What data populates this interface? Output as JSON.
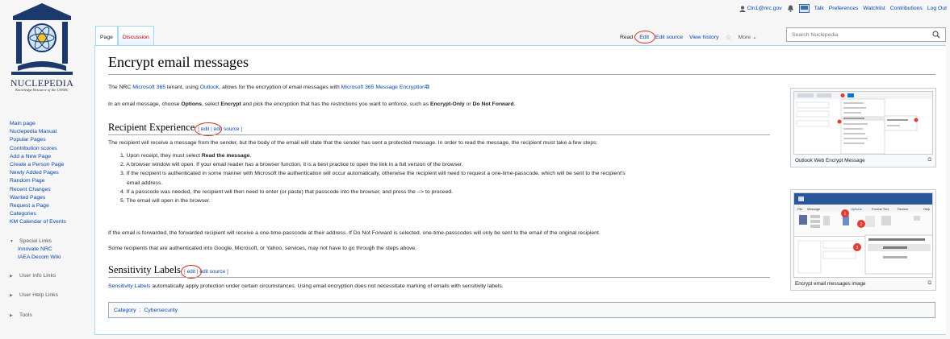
{
  "logo": {
    "name": "NUCLEPEDIA",
    "tagline": "Knowledge Resource of the USNRC"
  },
  "personal": {
    "user": "Cln1@nrc.gov",
    "items": [
      "Talk",
      "Preferences",
      "Watchlist",
      "Contributions",
      "Log Out"
    ]
  },
  "sidebar": {
    "portal": [
      "Main page",
      "Nuclepedia Manual",
      "Popular Pages",
      "Contribution scores",
      "Add a New Page",
      "Create a Person Page",
      "Newly Added Pages",
      "Random Page",
      "Recent Changes",
      "Wanted Pages",
      "Request a Page",
      "Categories",
      "KM Calendar of Events"
    ],
    "special_links": {
      "label": "Special Links",
      "items": [
        "Innovate NRC",
        "IAEA Decom Wiki"
      ]
    },
    "collapsed": [
      "User Info Links",
      "User Help Links",
      "Tools"
    ]
  },
  "tabs": {
    "left": [
      "Page",
      "Discussion"
    ],
    "right": {
      "read": "Read",
      "edit": "Edit",
      "edit_source": "Edit source",
      "view_history": "View history",
      "more": "More"
    }
  },
  "search": {
    "placeholder": "Search Nuclepedia"
  },
  "content": {
    "title": "Encrypt email messages",
    "intro": {
      "t1": "The NRC ",
      "l1": "Microsoft 365",
      "t2": " tenant, using ",
      "l2": "Outlook",
      "t3": ", allows for the encryption of email messages with ",
      "l3": "Microsoft 365 Message Encryption"
    },
    "options": {
      "t1": "In an email message, choose ",
      "b1": "Options",
      "t2": ", select ",
      "b2": "Encrypt",
      "t3": " and pick the encryption that has the restrictions you want to enforce, such as ",
      "b3": "Encrypt-Only",
      "t4": " or ",
      "b4": "Do Not Forward",
      "t5": "."
    },
    "section1": {
      "heading": "Recipient Experience",
      "edit": "edit",
      "edit_source": "edit source",
      "lead": "The recipient will receive a message from the sender, but the body of the email will state that the sender has sent a protected message. In order to read the message, the recipient must take a few steps:",
      "steps": [
        {
          "n": "1.",
          "t": "Upon receipt, they must select ",
          "b": "Read the message",
          "e": "."
        },
        {
          "n": "2.",
          "t": "A browser window will open. If your email reader has a browser function, it is a best practice to open the link in a full version of the browser."
        },
        {
          "n": "3.",
          "t": "If the recipient is authenticated in some manner with Microsoft the authentication will occur automatically, otherwise the recipient will need to request a one-time-passcode, which will be sent to the recipient's"
        },
        {
          "n": "",
          "t": "email address."
        },
        {
          "n": "4.",
          "t": "If a passcode was needed, the recipient will then need to enter (or paste) that passcode into the browser, and press the --> to proceed."
        },
        {
          "n": "5.",
          "t": "The email will open in the browser."
        }
      ],
      "forward": "If the email is forwarded, the forwarded recipient will receive a one-time-passcode at their address. If Do Not Forward is selected, one-time-passcodes will only be sent to the email of the original recipient.",
      "auth": "Some recipients that are authenticated into Google, Microsoft, or Yahoo, services, may not have to go through the steps above."
    },
    "section2": {
      "heading": "Sensitivity Labels",
      "edit": "edit",
      "edit_source": "edit source",
      "l1": "Sensitivity Labels",
      "t1": " automatically apply protection under certain circumstances. Using email encryption does not necessitate marking of emails with sensitivity labels."
    },
    "thumbs": [
      {
        "caption": "Outlook Web Encrypt Message"
      },
      {
        "caption": "Encrypt email messages image",
        "markers": [
          "1",
          "2",
          "3"
        ]
      }
    ],
    "category": {
      "label": "Category",
      "value": "Cybersecurity"
    }
  },
  "colors": {
    "link": "#0645ad",
    "highlight": "#d62d20",
    "border": "#a7d7f9"
  }
}
